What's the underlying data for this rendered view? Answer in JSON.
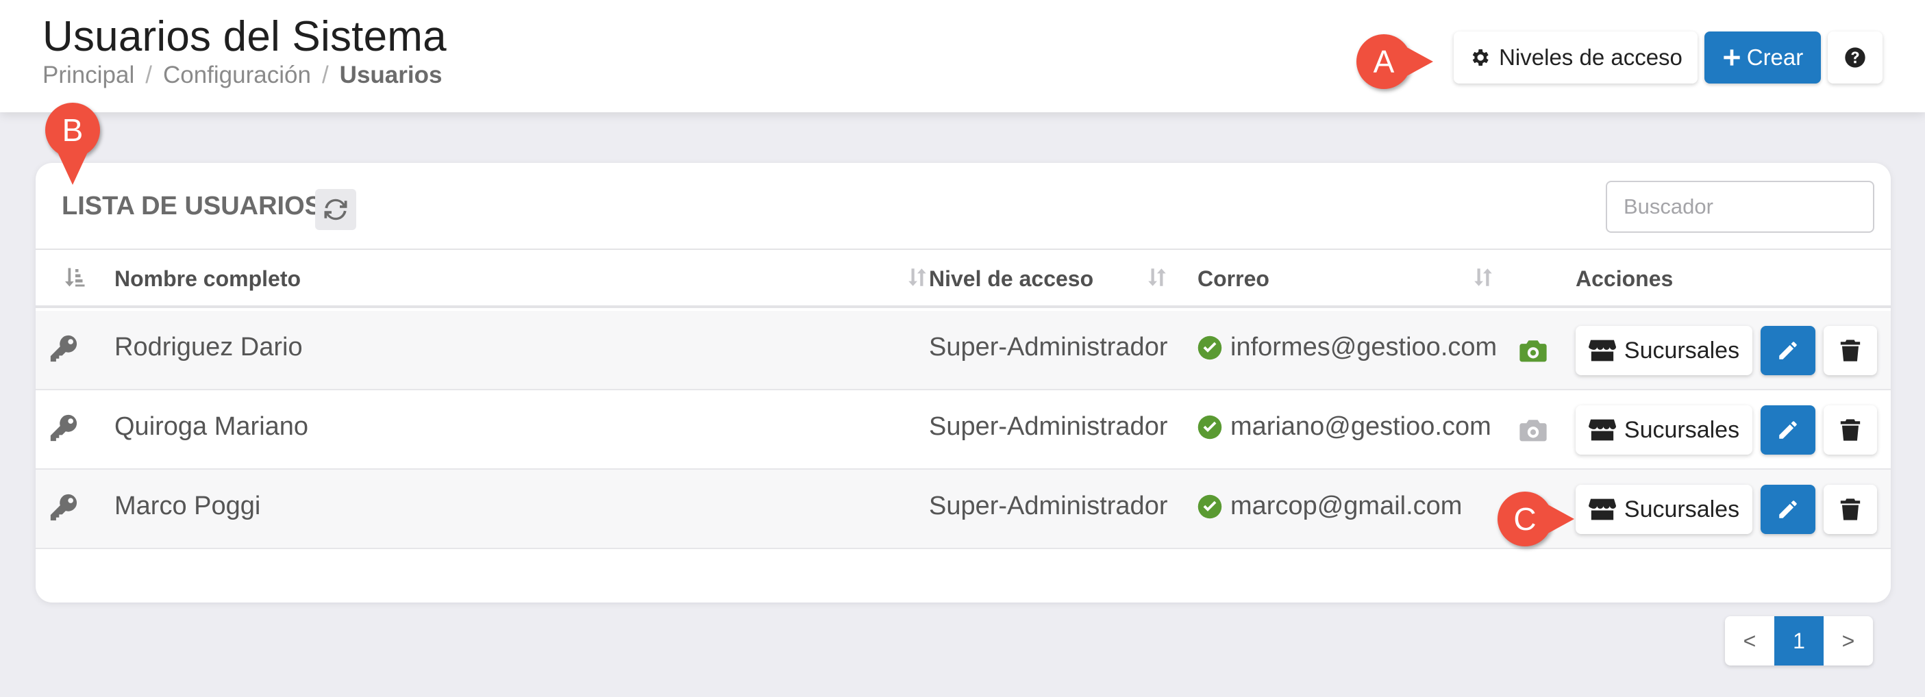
{
  "header": {
    "title": "Usuarios del Sistema",
    "breadcrumb": [
      "Principal",
      "Configuración",
      "Usuarios"
    ],
    "buttons": {
      "levels_label": "Niveles de acceso",
      "create_label": "Crear"
    }
  },
  "markers": {
    "a": "A",
    "b": "B",
    "c": "C"
  },
  "card": {
    "title": "LISTA DE USUARIOS",
    "search_placeholder": "Buscador",
    "columns": {
      "name": "Nombre completo",
      "level": "Nivel de acceso",
      "email": "Correo",
      "actions": "Acciones"
    },
    "rows": [
      {
        "name": "Rodriguez Dario",
        "level": "Super-Administrador",
        "email": "informes@gestioo.com",
        "photo": "camera-green",
        "branches_label": "Sucursales"
      },
      {
        "name": "Quiroga Mariano",
        "level": "Super-Administrador",
        "email": "mariano@gestioo.com",
        "photo": "camera-gray",
        "branches_label": "Sucursales"
      },
      {
        "name": "Marco Poggi",
        "level": "Super-Administrador",
        "email": "marcop@gmail.com",
        "photo": "none",
        "branches_label": "Sucursales"
      }
    ]
  },
  "pagination": {
    "prev": "<",
    "current": "1",
    "next": ">"
  },
  "colors": {
    "primary": "#1f7ac2",
    "marker": "#f0503e",
    "verified": "#5a9a32",
    "camera_active": "#5a9a32",
    "camera_inactive": "#b9b9bd"
  }
}
